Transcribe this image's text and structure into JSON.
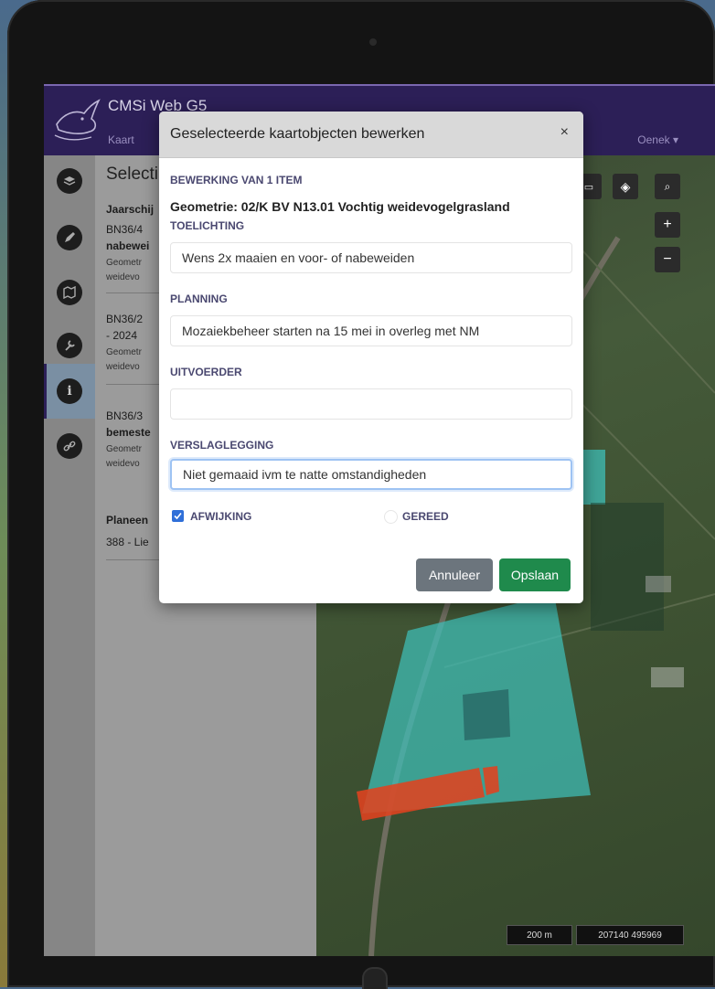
{
  "app": {
    "title": "CMSi Web G5",
    "nav_kaart": "Kaart",
    "user": "Oenek ▾"
  },
  "panel": {
    "title": "Selecti",
    "section1_title": "Jaarschij",
    "items": [
      {
        "line1": "BN36/4",
        "line2": "nabewei",
        "sub1": "Geometr",
        "sub2": "weidevo"
      },
      {
        "line1": "BN36/2",
        "line2": "- 2024",
        "sub1": "Geometr",
        "sub2": "weidevo"
      },
      {
        "line1": "BN36/3",
        "line2": "bemeste",
        "sub1": "Geometr",
        "sub2": "weidevo"
      }
    ],
    "section2_title": "Planeen",
    "section2_item": "388 - Lie"
  },
  "modal": {
    "title": "Geselecteerde kaartobjecten bewerken",
    "close": "×",
    "count_label": "BEWERKING VAN 1 ITEM",
    "geometry": "Geometrie: 02/K BV N13.01 Vochtig weidevogelgrasland",
    "fields": {
      "toelichting": {
        "label": "TOELICHTING",
        "value": "Wens 2x maaien en voor- of nabeweiden"
      },
      "planning": {
        "label": "PLANNING",
        "value": "Mozaiekbeheer starten na 15 mei in overleg met NM"
      },
      "uitvoerder": {
        "label": "UITVOERDER",
        "value": ""
      },
      "verslaglegging": {
        "label": "VERSLAGLEGGING",
        "value": "Niet gemaaid ivm te natte omstandigheden"
      }
    },
    "checkboxes": {
      "afwijking": {
        "label": "AFWIJKING",
        "checked": true
      },
      "gereed": {
        "label": "GEREED",
        "checked": false
      }
    },
    "buttons": {
      "cancel": "Annuleer",
      "save": "Opslaan"
    }
  },
  "map": {
    "zoom_in": "+",
    "zoom_out": "−",
    "scale": "200 m",
    "coordinates": "207140 495969"
  },
  "colors": {
    "appbar": "#2c1f57",
    "save_button": "#1f8a4c",
    "cancel_button": "#6c757d",
    "parcel_cyan": "#3fbfb8",
    "parcel_red": "#e0421f"
  }
}
